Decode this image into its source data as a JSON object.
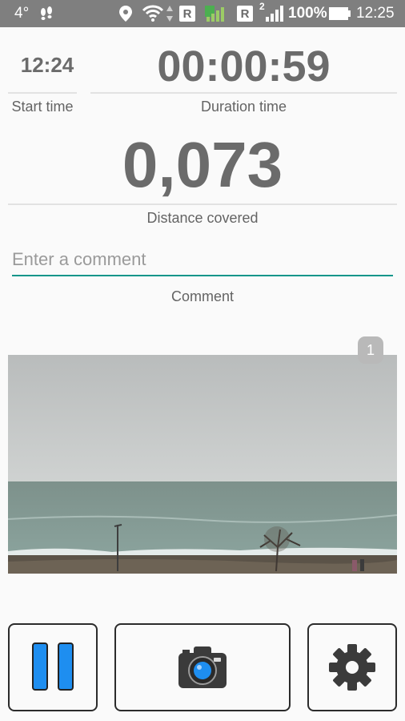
{
  "status_bar": {
    "temperature": "4°",
    "network_badge_1": "R",
    "network_badge_2": "R",
    "sim_number": "2",
    "battery": "100%",
    "clock": "12:25"
  },
  "stats": {
    "start_time_value": "12:24",
    "start_time_label": "Start time",
    "duration_value": "00:00:59",
    "duration_label": "Duration time",
    "distance_value": "0,073",
    "distance_label": "Distance covered"
  },
  "comment": {
    "placeholder": "Enter a comment",
    "value": "",
    "label": "Comment"
  },
  "photo": {
    "count_badge": "1"
  },
  "buttons": {
    "pause": "pause-button",
    "camera": "camera-button",
    "settings": "settings-button"
  },
  "colors": {
    "accent": "#12968a",
    "pause_blue": "#1e8ef0",
    "icon_dark": "#3b3b3b",
    "status_bar": "#7f7f7f"
  }
}
